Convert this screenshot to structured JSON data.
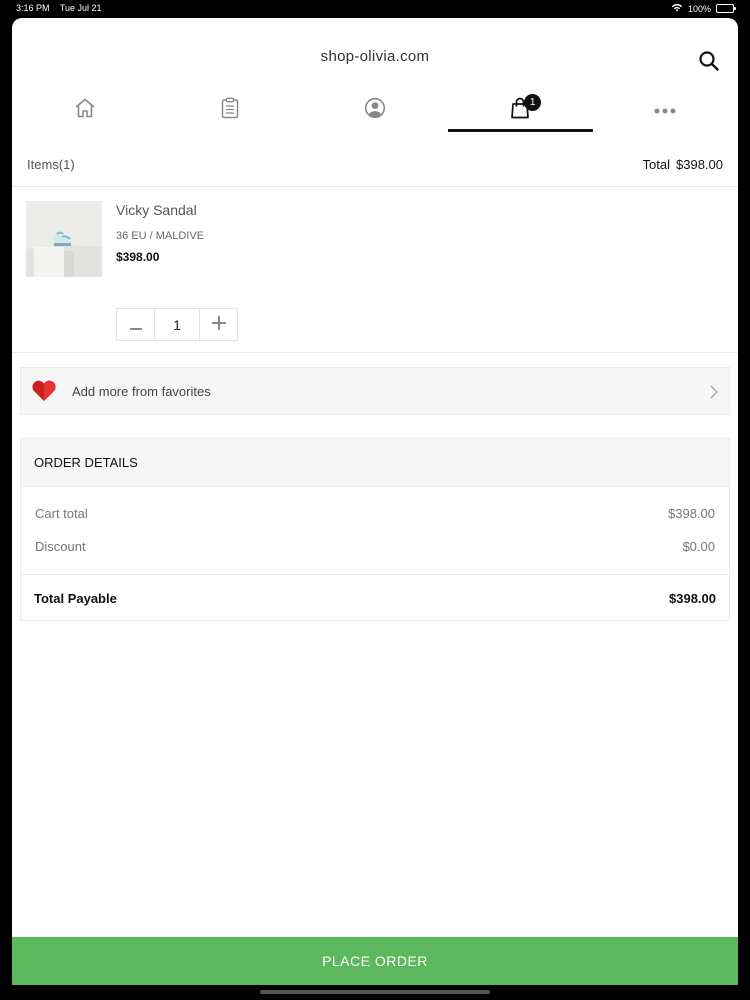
{
  "status_bar": {
    "time": "3:16 PM",
    "date": "Tue Jul 21",
    "battery": "100%"
  },
  "header": {
    "title": "shop-olivia.com",
    "search_icon": "search-icon"
  },
  "nav": {
    "tabs": [
      {
        "icon": "home-icon"
      },
      {
        "icon": "clipboard-icon"
      },
      {
        "icon": "user-circle-icon"
      },
      {
        "icon": "shopping-bag-icon",
        "badge": "1",
        "active": true
      },
      {
        "icon": "more-dots-icon"
      }
    ]
  },
  "summary": {
    "items_label": "Items(1)",
    "total_label": "Total",
    "total_value": "$398.00"
  },
  "cart": {
    "items": [
      {
        "name": "Vicky Sandal",
        "variant": "36 EU / MALDIVE",
        "price": "$398.00",
        "quantity": "1"
      }
    ]
  },
  "favorites": {
    "label": "Add more from favorites",
    "icon": "heart-icon"
  },
  "order_details": {
    "title": "ORDER DETAILS",
    "rows": [
      {
        "label": "Cart total",
        "value": "$398.00"
      },
      {
        "label": "Discount",
        "value": "$0.00"
      }
    ],
    "total_label": "Total Payable",
    "total_value": "$398.00"
  },
  "actions": {
    "place_order": "PLACE ORDER"
  },
  "colors": {
    "primary_button": "#5cb85c",
    "heart": "#cc1f1f",
    "active_tab": "#111111"
  }
}
